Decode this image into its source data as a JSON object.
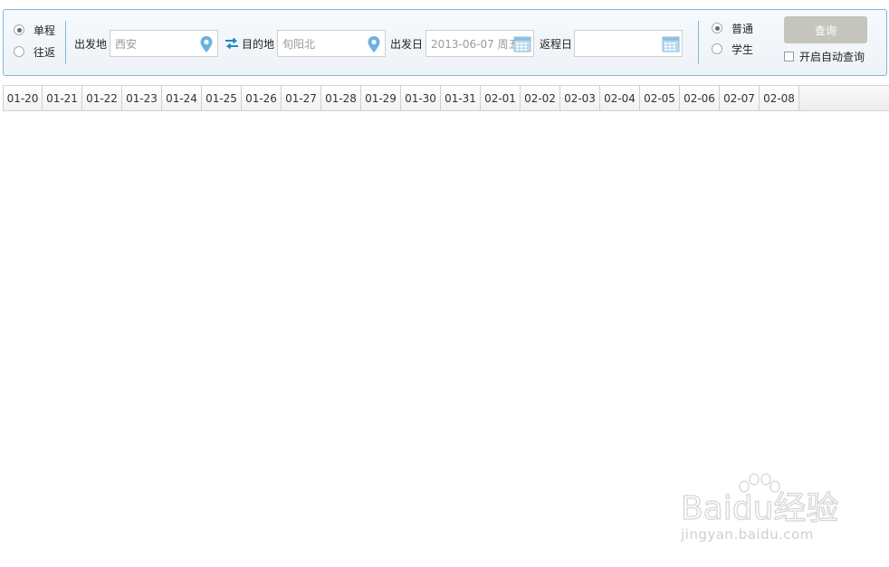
{
  "search": {
    "trip_type": {
      "options": [
        {
          "label": "单程",
          "checked": true
        },
        {
          "label": "往返",
          "checked": false
        }
      ]
    },
    "from_label": "出发地",
    "from_value": "西安",
    "to_label": "目的地",
    "to_value": "旬阳北",
    "depart_label": "出发日",
    "depart_value": "2013-06-07 周五",
    "return_label": "返程日",
    "return_value": "",
    "ticket_type": {
      "options": [
        {
          "label": "普通",
          "checked": true
        },
        {
          "label": "学生",
          "checked": false
        }
      ]
    },
    "query_button": "查询",
    "auto_query_label": "开启自动查询",
    "auto_query_checked": false
  },
  "date_tabs": [
    "01-20",
    "01-21",
    "01-22",
    "01-23",
    "01-24",
    "01-25",
    "01-26",
    "01-27",
    "01-28",
    "01-29",
    "01-30",
    "01-31",
    "02-01",
    "02-02",
    "02-03",
    "02-04",
    "02-05",
    "02-06",
    "02-07",
    "02-08"
  ],
  "watermark": {
    "logo_text": "Baidu经验",
    "url": "jingyan.baidu.com"
  },
  "colors": {
    "panel_border": "#7fb8d6",
    "accent_icon": "#1e88c8",
    "query_button_bg": "#c5c5bd"
  }
}
